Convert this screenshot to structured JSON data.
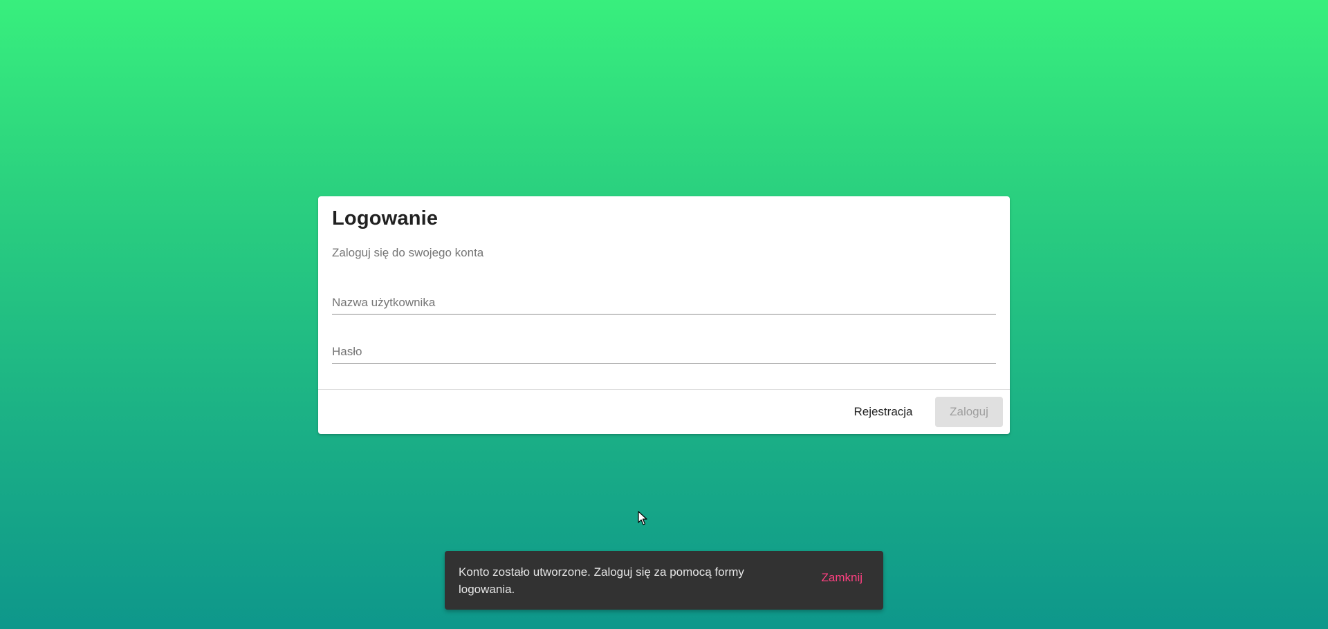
{
  "login_card": {
    "title": "Logowanie",
    "subtitle": "Zaloguj się do swojego konta",
    "username_placeholder": "Nazwa użytkownika",
    "username_value": "",
    "password_placeholder": "Hasło",
    "password_value": "",
    "register_label": "Rejestracja",
    "login_label": "Zaloguj",
    "login_disabled": true
  },
  "snackbar": {
    "message": "Konto zostało utworzone. Zaloguj się za pomocą formy logowania.",
    "action_label": "Zamknij",
    "action_color": "#ff4081"
  },
  "cursor": {
    "icon": "mouse-pointer-icon"
  },
  "colors": {
    "background_top": "#38ef7d",
    "background_bottom": "#0e978b",
    "disabled_button": "#e0e0e0"
  }
}
